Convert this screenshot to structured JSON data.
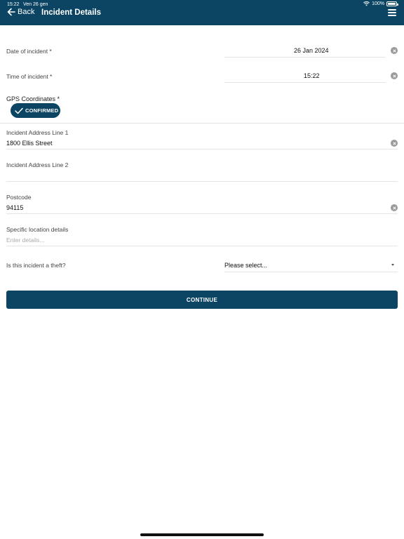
{
  "status_bar": {
    "time": "15:22",
    "date": "Ven 26 gen",
    "battery": "100%"
  },
  "header": {
    "back_label": "Back",
    "title": "Incident Details"
  },
  "form": {
    "date": {
      "label": "Date of incident *",
      "value": "26 Jan 2024"
    },
    "time": {
      "label": "Time of incident *",
      "value": "15:22"
    },
    "gps": {
      "label": "GPS Coordinates *",
      "status": "CONFIRMED"
    },
    "address1": {
      "label": "Incident Address Line 1",
      "value": "1800 Ellis Street"
    },
    "address2": {
      "label": "Incident Address Line 2",
      "value": ""
    },
    "postcode": {
      "label": "Postcode",
      "value": "94115"
    },
    "location": {
      "label": "Specific location details",
      "placeholder": "Enter details..."
    },
    "theft": {
      "label": "Is this incident a theft?",
      "value": "Please select..."
    }
  },
  "actions": {
    "continue_label": "CONTINUE"
  },
  "colors": {
    "primary": "#0b4563",
    "clear_icon": "#9a9a9a"
  }
}
